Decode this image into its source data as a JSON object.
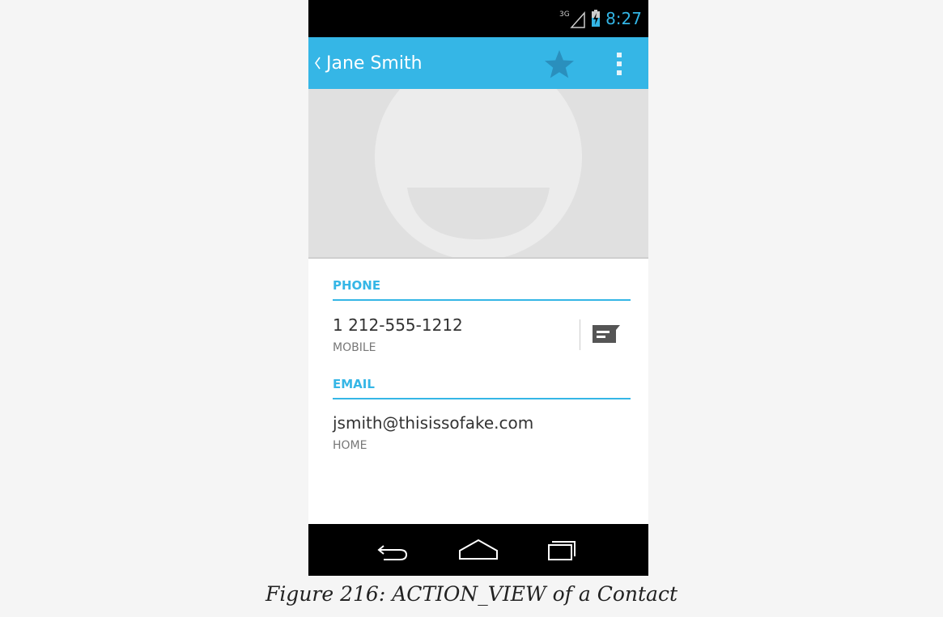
{
  "status_bar": {
    "network_label": "3G",
    "time": "8:27",
    "accent_color": "#33b5e5"
  },
  "action_bar": {
    "title": "Jane Smith",
    "background_color": "#35b6e6",
    "icons": [
      "back-chevron-icon",
      "star-icon",
      "overflow-menu-icon"
    ]
  },
  "contact": {
    "photo_placeholder": "default-avatar-icon",
    "sections": [
      {
        "header": "PHONE",
        "entries": [
          {
            "value": "1 212-555-1212",
            "type": "MOBILE",
            "action_icon": "message-icon"
          }
        ]
      },
      {
        "header": "EMAIL",
        "entries": [
          {
            "value": "jsmith@thisissofake.com",
            "type": "HOME"
          }
        ]
      }
    ]
  },
  "nav_bar": {
    "icons": [
      "back-icon",
      "home-icon",
      "recents-icon"
    ]
  },
  "caption": "Figure 216: ACTION_VIEW of a Contact"
}
